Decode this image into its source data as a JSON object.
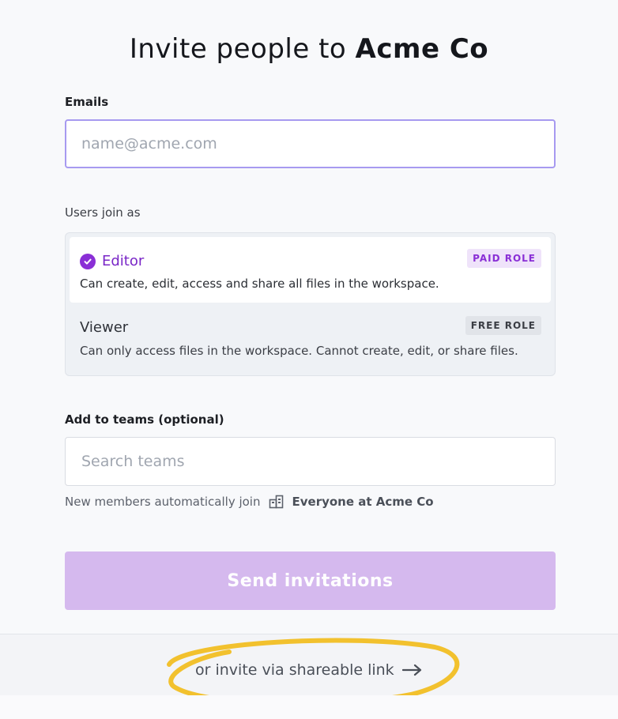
{
  "header": {
    "title_prefix": "Invite people to",
    "title_org": "Acme Co"
  },
  "emails": {
    "label": "Emails",
    "placeholder": "name@acme.com",
    "value": ""
  },
  "roles": {
    "label": "Users join as",
    "items": [
      {
        "name": "Editor",
        "badge": "PAID ROLE",
        "description": "Can create, edit, access and share all files in the workspace.",
        "selected": true
      },
      {
        "name": "Viewer",
        "badge": "FREE ROLE",
        "description": "Can only access files in the workspace. Cannot create, edit, or share files.",
        "selected": false
      }
    ]
  },
  "teams": {
    "label": "Add to teams (optional)",
    "placeholder": "Search teams",
    "value": "",
    "helper_text": "New members automatically join",
    "default_team": "Everyone at Acme Co",
    "team_icon": "building-icon"
  },
  "actions": {
    "send_label": "Send invitations",
    "send_color": "#d5b9ee"
  },
  "footer": {
    "share_link_label": "or invite via shareable link",
    "arrow_icon": "arrow-right-icon"
  },
  "colors": {
    "accent": "#8a2fd6",
    "highlight": "#f2c12e"
  }
}
